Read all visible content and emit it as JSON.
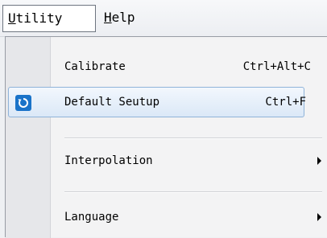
{
  "menubar": {
    "items": [
      {
        "accel": "U",
        "rest": "tility"
      },
      {
        "accel": "H",
        "rest": "elp"
      }
    ]
  },
  "menu": {
    "items": [
      {
        "label": "Calibrate",
        "shortcut": "Ctrl+Alt+C"
      },
      {
        "label": "Default Seutup",
        "shortcut": "Ctrl+F",
        "icon": "default-reset-icon"
      },
      {
        "label": "Interpolation",
        "submenu": true
      },
      {
        "label": "Language",
        "submenu": true
      }
    ]
  },
  "colors": {
    "highlight_border": "#8fb3d9",
    "highlight_fill": "#dbe8f7",
    "icon_bg": "#1a73c9"
  }
}
